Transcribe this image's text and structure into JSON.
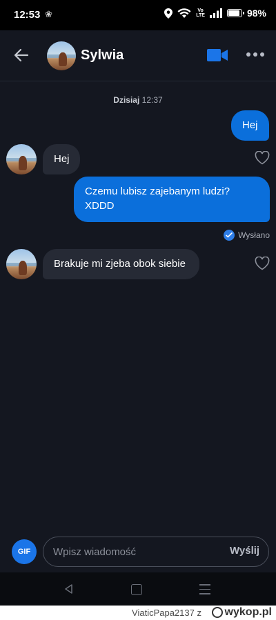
{
  "status_bar": {
    "time": "12:53",
    "battery": "98%",
    "network": "Vo LTE",
    "battery_level": 0.98
  },
  "header": {
    "contact_name": "Sylwia"
  },
  "chat": {
    "date_label": "Dzisiaj",
    "date_time": "12:37",
    "messages": [
      {
        "direction": "out",
        "text": "Hej"
      },
      {
        "direction": "in",
        "text": "Hej"
      },
      {
        "direction": "out",
        "text": "Czemu lubisz zajebanym ludzi? XDDD"
      },
      {
        "direction": "in",
        "text": "Brakuje mi zjeba obok siebie"
      }
    ],
    "sent_status": "Wysłano"
  },
  "composer": {
    "gif_label": "GIF",
    "placeholder": "Wpisz wiadomość",
    "send_label": "Wyślij"
  },
  "watermark": {
    "user": "ViaticPapa2137",
    "separator": "z",
    "site": "wykop.pl"
  },
  "colors": {
    "background": "#141720",
    "outgoing_bubble": "#0b6fdb",
    "incoming_bubble": "#262a35",
    "accent": "#1b75e8"
  }
}
